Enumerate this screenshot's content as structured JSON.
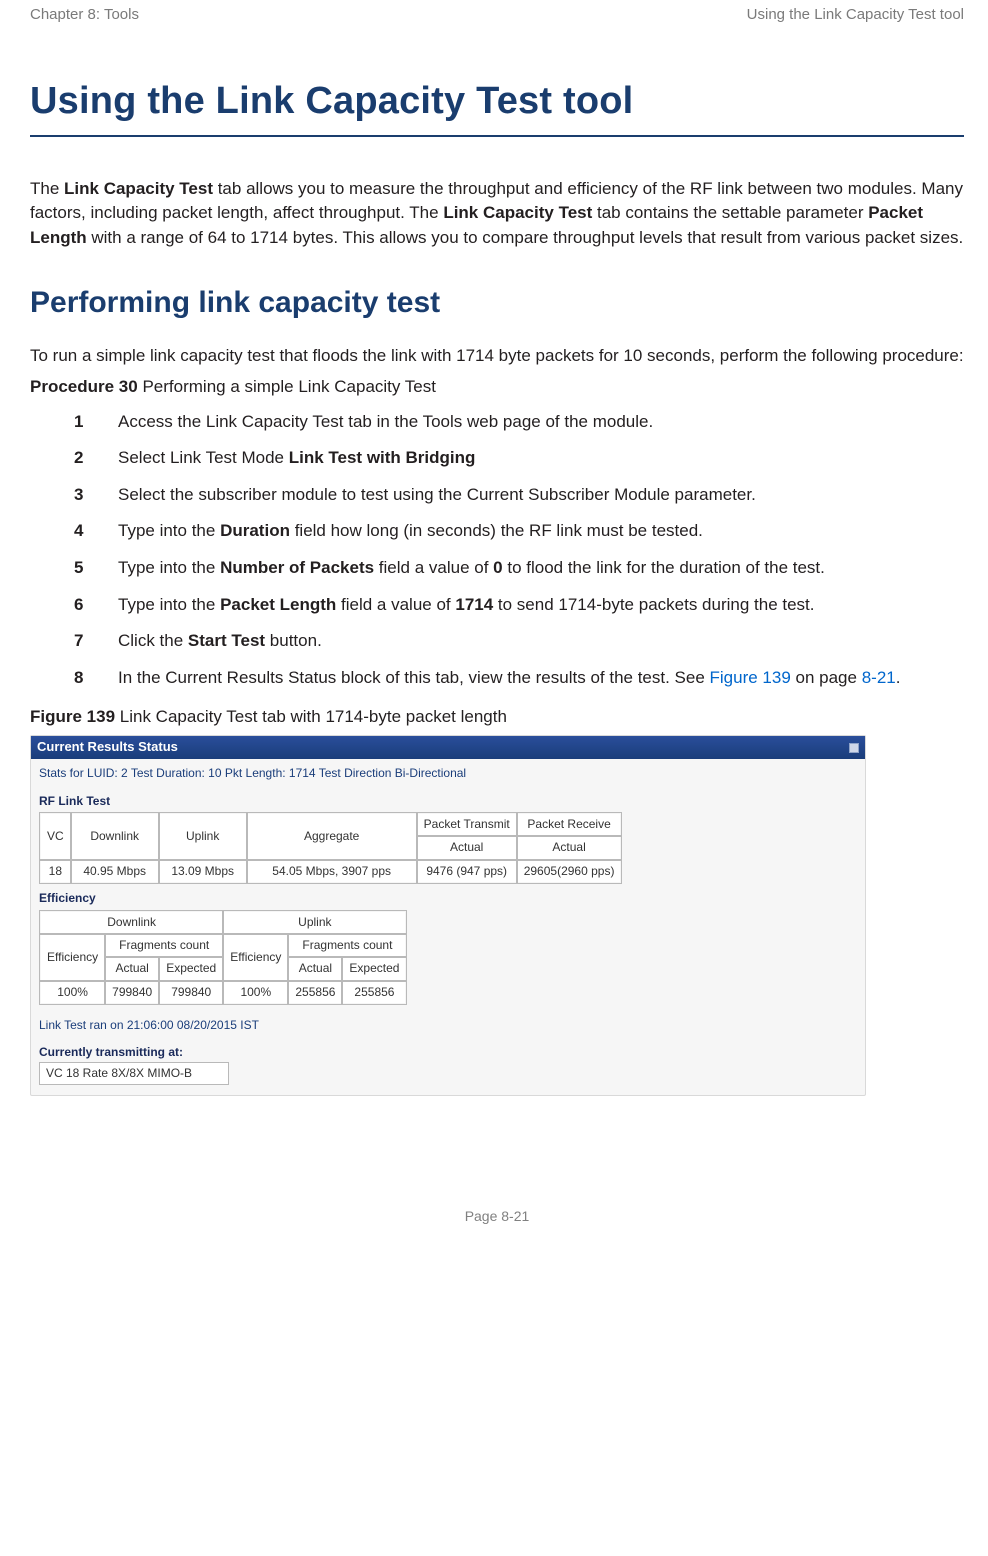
{
  "header": {
    "left": "Chapter 8:  Tools",
    "right": "Using the Link Capacity Test tool"
  },
  "title": "Using the Link Capacity Test tool",
  "lead": {
    "t1": "The ",
    "b1": "Link Capacity Test",
    "t2": " tab allows you to measure the throughput and efficiency of the RF link between two modules. Many factors, including packet length, affect throughput. The ",
    "b2": "Link Capacity Test",
    "t3": " tab contains the settable parameter ",
    "b3": "Packet Length",
    "t4": " with a range of 64 to 1714 bytes. This allows you to compare throughput levels that result from various packet sizes."
  },
  "section2": "Performing link capacity test",
  "intro": "To run a simple link capacity test that floods the link with 1714 byte packets for 10 seconds, perform the following procedure:",
  "procLabel": {
    "b": "Procedure 30",
    "rest": " Performing a simple Link Capacity Test"
  },
  "steps": [
    {
      "n": "1",
      "plain": "Access the Link Capacity Test tab in the Tools web page of the module."
    },
    {
      "n": "2",
      "pre": "Select Link Test Mode ",
      "b": "Link Test with Bridging",
      "post": ""
    },
    {
      "n": "3",
      "plain": "Select the subscriber module to test using the Current Subscriber Module parameter."
    },
    {
      "n": "4",
      "pre": "Type into the ",
      "b": "Duration",
      "post": " field how long (in seconds) the RF link must be tested."
    },
    {
      "n": "5",
      "pre": "Type into the ",
      "b": "Number of Packets",
      "mid": " field a value of ",
      "b2": "0",
      "post": " to flood the link for the duration of the test."
    },
    {
      "n": "6",
      "pre": "Type into the ",
      "b": "Packet Length",
      "mid": " field a value of ",
      "b2": "1714",
      "post": " to send 1714-byte packets during the test."
    },
    {
      "n": "7",
      "pre": "Click the ",
      "b": "Start Test",
      "post": " button."
    },
    {
      "n": "8",
      "pre": "In the Current Results Status block of this tab, view the results of the test. See ",
      "link1": "Figure 139",
      "mid2": " on page ",
      "link2": "8-21",
      "post2": "."
    }
  ],
  "figure": {
    "label": {
      "b": "Figure 139",
      "rest": " Link Capacity Test tab with 1714-byte packet length"
    },
    "panelTitle": "Current Results Status",
    "statsLine": "Stats for LUID: 2   Test Duration: 10   Pkt Length: 1714   Test Direction Bi-Directional",
    "rfLabel": "RF Link Test",
    "rfHead": {
      "vc": "VC",
      "dl": "Downlink",
      "ul": "Uplink",
      "agg": "Aggregate",
      "pt": "Packet Transmit",
      "pr": "Packet Receive",
      "act1": "Actual",
      "act2": "Actual"
    },
    "rfRow": {
      "vc": "18",
      "dl": "40.95 Mbps",
      "ul": "13.09 Mbps",
      "agg": "54.05 Mbps,  3907 pps",
      "pt": "9476 (947 pps)",
      "pr": "29605(2960 pps)"
    },
    "effLabel": "Efficiency",
    "effHead": {
      "dl": "Downlink",
      "ul": "Uplink",
      "eff": "Efficiency",
      "fc": "Fragments count",
      "act": "Actual",
      "exp": "Expected"
    },
    "effRow": {
      "e1": "100%",
      "a1": "799840",
      "x1": "799840",
      "e2": "100%",
      "a2": "255856",
      "x2": "255856"
    },
    "timestamp": "Link Test ran on 21:06:00 08/20/2015 IST",
    "curLabel": "Currently transmitting at:",
    "curRate": "VC 18 Rate 8X/8X MIMO-B"
  },
  "footer": "Page 8-21"
}
